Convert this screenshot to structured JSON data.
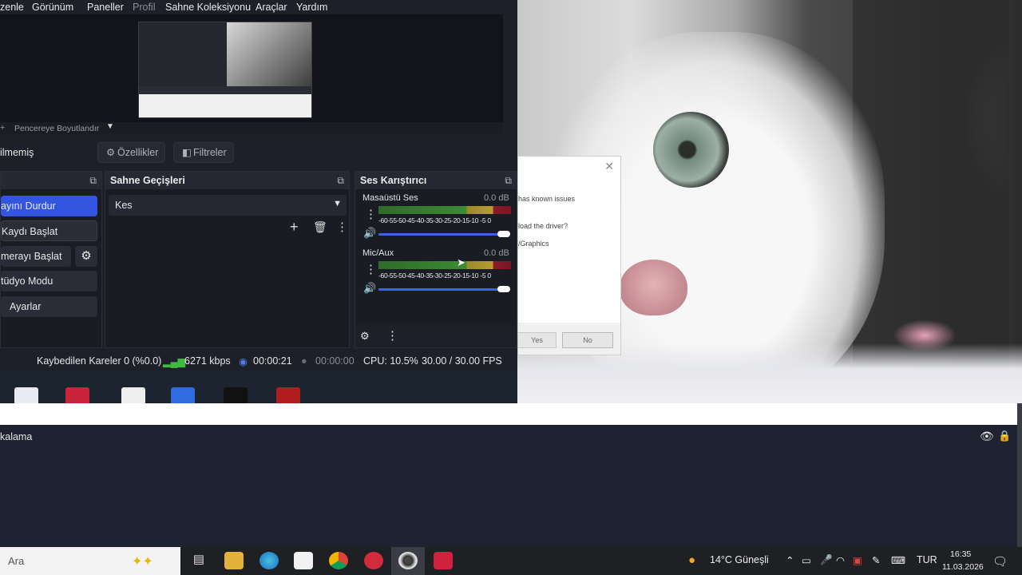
{
  "menu": [
    "zenle",
    "Görünüm",
    "Paneller",
    "Profil",
    "Sahne Koleksiyonu",
    "Araçlar",
    "Yardım"
  ],
  "preview": {
    "resize_label": "Pencereye Boyutlandır",
    "plus": "+"
  },
  "source_bar": {
    "title": "ilmemiş",
    "properties": "Özellikler",
    "filters": "Filtreler"
  },
  "controls": {
    "title": "",
    "buttons": [
      "ayını Durdur",
      "Kaydı Başlat",
      "merayı Başlat",
      "tüdyo Modu",
      "Ayarlar"
    ]
  },
  "transitions": {
    "title": "Sahne Geçişleri",
    "selected": "Kes"
  },
  "mixer": {
    "title": "Ses Karıştırıcı",
    "channels": [
      {
        "name": "Masaüstü Ses",
        "db": "0.0 dB",
        "level": 0.95
      },
      {
        "name": "Mic/Aux",
        "db": "0.0 dB",
        "level": 0.95
      }
    ],
    "ticks": "-60-55-50-45-40-35-30-25-20-15-10 -5  0"
  },
  "status": {
    "dropped": "Kaybedilen Kareler 0 (%0.0)",
    "bitrate": "6271 kbps",
    "live_time": "00:00:21",
    "rec_time": "00:00:00",
    "cpu": "CPU: 10.5%",
    "fps": "30.00 / 30.00 FPS"
  },
  "dialog": {
    "line1": "has known issues",
    "line2": "load the driver?",
    "line3": "/Graphics",
    "yes": "Yes",
    "no": "No"
  },
  "lower": {
    "label": "kalama"
  },
  "taskbar": {
    "search": "Ara",
    "weather": "14°C  Güneşli",
    "lang": "TUR",
    "time": "16:35",
    "date": "11.03.2026"
  },
  "colors": {
    "accent": "#3355e0",
    "meter_green": "#3c8a32",
    "meter_yellow": "#b89b2f",
    "meter_red": "#8a1a2a"
  }
}
